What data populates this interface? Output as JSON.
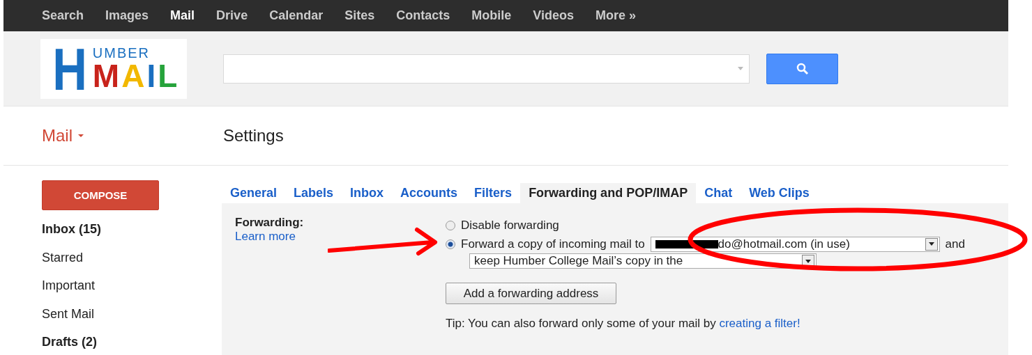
{
  "top_nav": [
    {
      "label": "Search",
      "selected": false
    },
    {
      "label": "Images",
      "selected": false
    },
    {
      "label": "Mail",
      "selected": true
    },
    {
      "label": "Drive",
      "selected": false
    },
    {
      "label": "Calendar",
      "selected": false
    },
    {
      "label": "Sites",
      "selected": false
    },
    {
      "label": "Contacts",
      "selected": false
    },
    {
      "label": "Mobile",
      "selected": false
    },
    {
      "label": "Videos",
      "selected": false
    },
    {
      "label": "More »",
      "selected": false
    }
  ],
  "logo": {
    "initial": "H",
    "top": "UMBER",
    "bottom": "MAIL"
  },
  "app_menu": {
    "label": "Mail"
  },
  "page_title": "Settings",
  "compose": "COMPOSE",
  "sidebar": {
    "items": [
      {
        "label": "Inbox (15)",
        "unread": true
      },
      {
        "label": "Starred",
        "unread": false
      },
      {
        "label": "Important",
        "unread": false
      },
      {
        "label": "Sent Mail",
        "unread": false
      },
      {
        "label": "Drafts (2)",
        "unread": true
      }
    ]
  },
  "tabs": [
    {
      "label": "General",
      "selected": false
    },
    {
      "label": "Labels",
      "selected": false
    },
    {
      "label": "Inbox",
      "selected": false
    },
    {
      "label": "Accounts",
      "selected": false
    },
    {
      "label": "Filters",
      "selected": false
    },
    {
      "label": "Forwarding and POP/IMAP",
      "selected": true
    },
    {
      "label": "Chat",
      "selected": false
    },
    {
      "label": "Web Clips",
      "selected": false
    }
  ],
  "forwarding": {
    "label": "Forwarding:",
    "learn_more": "Learn more",
    "options": [
      {
        "label": "Disable forwarding",
        "selected": false
      },
      {
        "label": "Forward a copy of incoming mail to",
        "selected": true
      }
    ],
    "address": "do@hotmail.com (in use)",
    "and": "and",
    "action": "keep Humber College Mail’s copy in the",
    "add_button": "Add a forwarding address",
    "tip": "Tip: You can also forward only some of your mail by",
    "tip_link": "creating a filter!"
  },
  "annotations": [
    {
      "kind": "arrow"
    },
    {
      "kind": "ellipse"
    }
  ]
}
